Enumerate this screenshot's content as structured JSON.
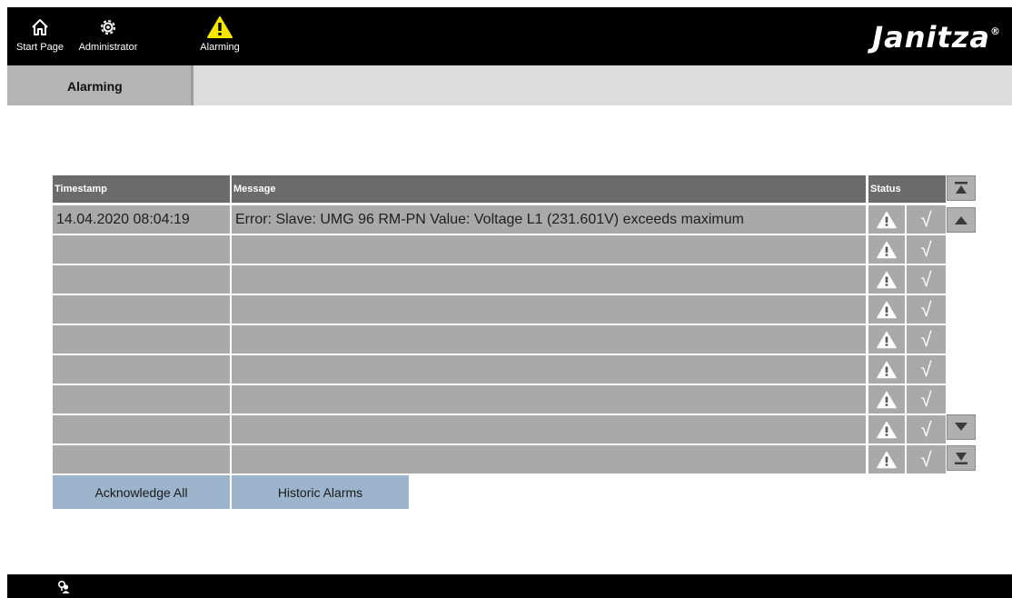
{
  "nav": {
    "items": [
      {
        "label": "Start Page",
        "icon": "home-icon"
      },
      {
        "label": "Administrator",
        "icon": "gear-icon"
      },
      {
        "label": "Alarming",
        "icon": "warning-icon"
      }
    ],
    "brand": "Janitza",
    "brand_mark": "®"
  },
  "tabs": {
    "active": "Alarming"
  },
  "table": {
    "headers": {
      "timestamp": "Timestamp",
      "message": "Message",
      "status": "Status"
    },
    "rows": [
      {
        "timestamp": "14.04.2020 08:04:19",
        "message": "Error: Slave: UMG 96 RM-PN Value: Voltage L1 (231.601V) exceeds maximum"
      },
      {
        "timestamp": "",
        "message": ""
      },
      {
        "timestamp": "",
        "message": ""
      },
      {
        "timestamp": "",
        "message": ""
      },
      {
        "timestamp": "",
        "message": ""
      },
      {
        "timestamp": "",
        "message": ""
      },
      {
        "timestamp": "",
        "message": ""
      },
      {
        "timestamp": "",
        "message": ""
      },
      {
        "timestamp": "",
        "message": ""
      }
    ],
    "ack_glyph": "√"
  },
  "buttons": {
    "acknowledge_all": "Acknowledge All",
    "historic_alarms": "Historic Alarms"
  },
  "colors": {
    "topbar": "#000000",
    "accent_warning": "#f5e600",
    "header_bg": "#6b6b6b",
    "row_bg": "#a9a9a9",
    "button_bg": "#9cb5cd"
  }
}
